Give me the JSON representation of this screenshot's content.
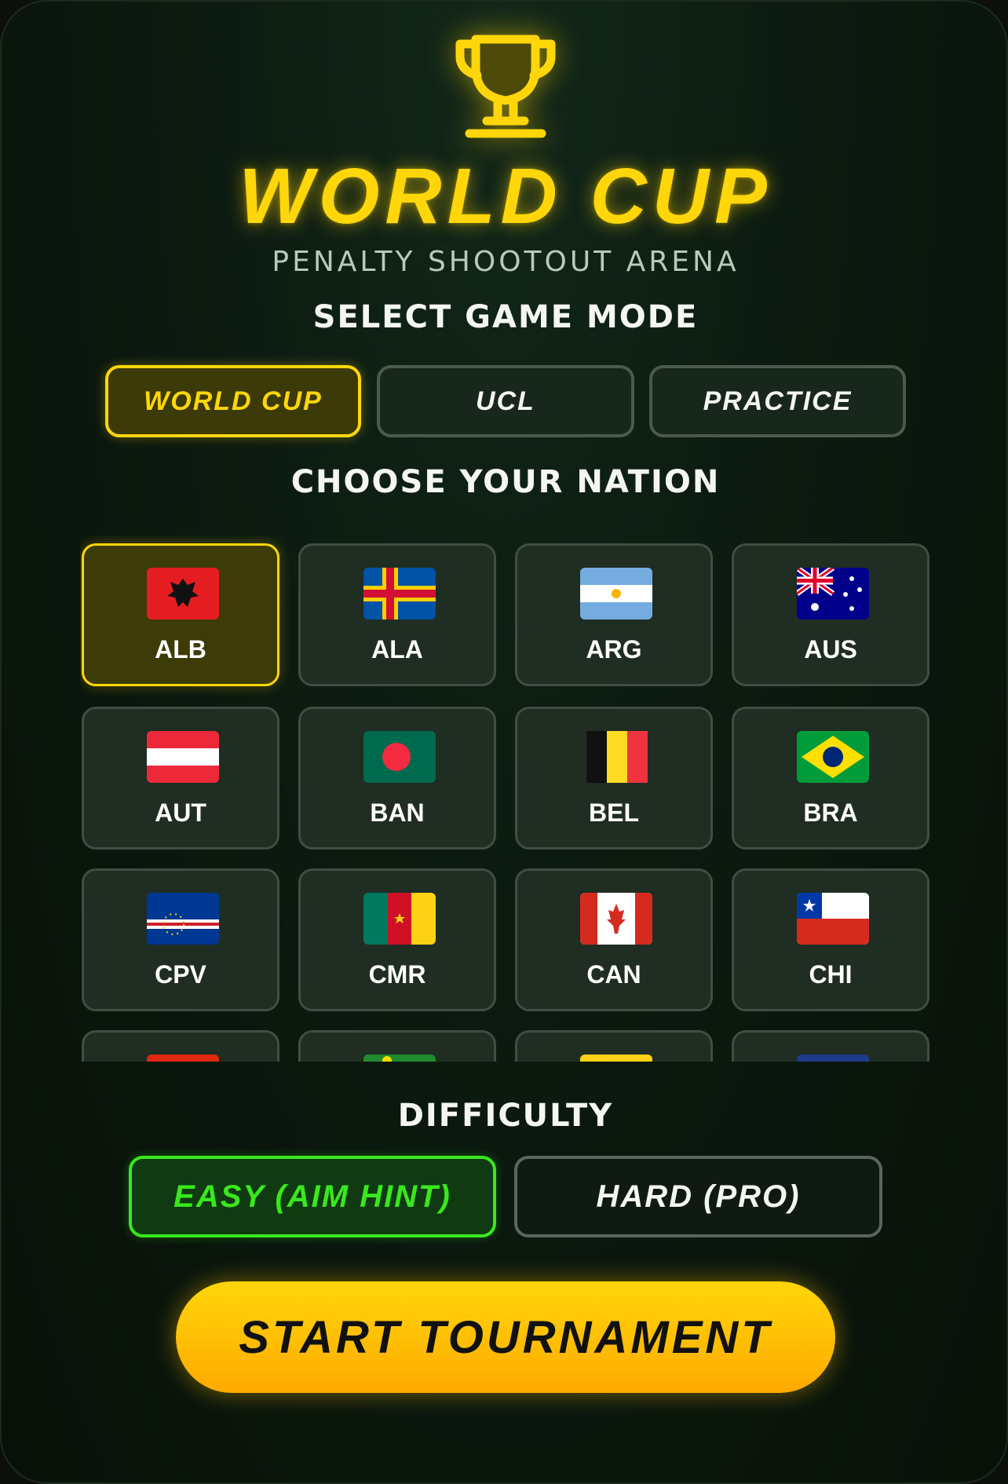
{
  "header": {
    "title": "WORLD CUP",
    "subtitle": "PENALTY SHOOTOUT ARENA",
    "trophy_icon": "trophy-icon"
  },
  "game_mode": {
    "label": "SELECT GAME MODE",
    "options": [
      {
        "label": "WORLD CUP",
        "selected": true
      },
      {
        "label": "UCL",
        "selected": false
      },
      {
        "label": "PRACTICE",
        "selected": false
      }
    ]
  },
  "nation": {
    "label": "CHOOSE YOUR NATION",
    "items": [
      {
        "code": "ALB",
        "flag": "albania-flag",
        "selected": true
      },
      {
        "code": "ALA",
        "flag": "aland-flag",
        "selected": false
      },
      {
        "code": "ARG",
        "flag": "argentina-flag",
        "selected": false
      },
      {
        "code": "AUS",
        "flag": "australia-flag",
        "selected": false
      },
      {
        "code": "AUT",
        "flag": "austria-flag",
        "selected": false
      },
      {
        "code": "BAN",
        "flag": "bangladesh-flag",
        "selected": false
      },
      {
        "code": "BEL",
        "flag": "belgium-flag",
        "selected": false
      },
      {
        "code": "BRA",
        "flag": "brazil-flag",
        "selected": false
      },
      {
        "code": "CPV",
        "flag": "cape-verde-flag",
        "selected": false
      },
      {
        "code": "CMR",
        "flag": "cameroon-flag",
        "selected": false
      },
      {
        "code": "CAN",
        "flag": "canada-flag",
        "selected": false
      },
      {
        "code": "CHI",
        "flag": "chile-flag",
        "selected": false
      }
    ]
  },
  "difficulty": {
    "label": "DIFFICULTY",
    "options": [
      {
        "label": "EASY (AIM HINT)",
        "selected": true
      },
      {
        "label": "HARD (PRO)",
        "selected": false
      }
    ]
  },
  "start_button": {
    "label": "START TOURNAMENT"
  },
  "colors": {
    "accent_gold": "#ffd60a",
    "accent_green": "#39e81d",
    "background": "#0c1a10"
  }
}
